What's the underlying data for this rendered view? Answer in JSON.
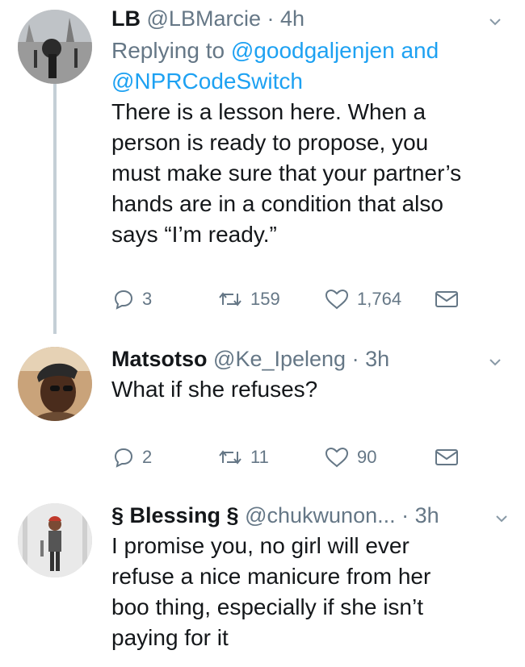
{
  "tweets": [
    {
      "name": "LB",
      "handle": "@LBMarcie",
      "separator": "·",
      "time": "4h",
      "replying_prefix": "Replying to",
      "replying_user1": "@goodgaljenjen",
      "replying_and": "and",
      "replying_user2": "@NPRCodeSwitch",
      "text_lines": [
        "There is a lesson here. When a",
        "person is ready to propose, you",
        "must make sure that your partner’s",
        "hands are in a condition that also",
        "says “I’m ready.”"
      ],
      "replies": "3",
      "retweets": "159",
      "likes": "1,764"
    },
    {
      "name": "Matsotso",
      "handle": "@Ke_Ipeleng",
      "separator": "·",
      "time": "3h",
      "text_lines": [
        "What if she refuses?"
      ],
      "replies": "2",
      "retweets": "11",
      "likes": "90"
    },
    {
      "name": "§ Blessing §",
      "handle": "@chukwunon...",
      "separator": "·",
      "time": "3h",
      "text_lines": [
        "I promise you, no girl will ever",
        "refuse a nice manicure from her",
        "boo thing, especially if she isn’t",
        "paying for it"
      ]
    }
  ],
  "colors": {
    "link": "#1da1f2",
    "secondary_text": "#657786",
    "thread_line": "#c4cfd6"
  }
}
